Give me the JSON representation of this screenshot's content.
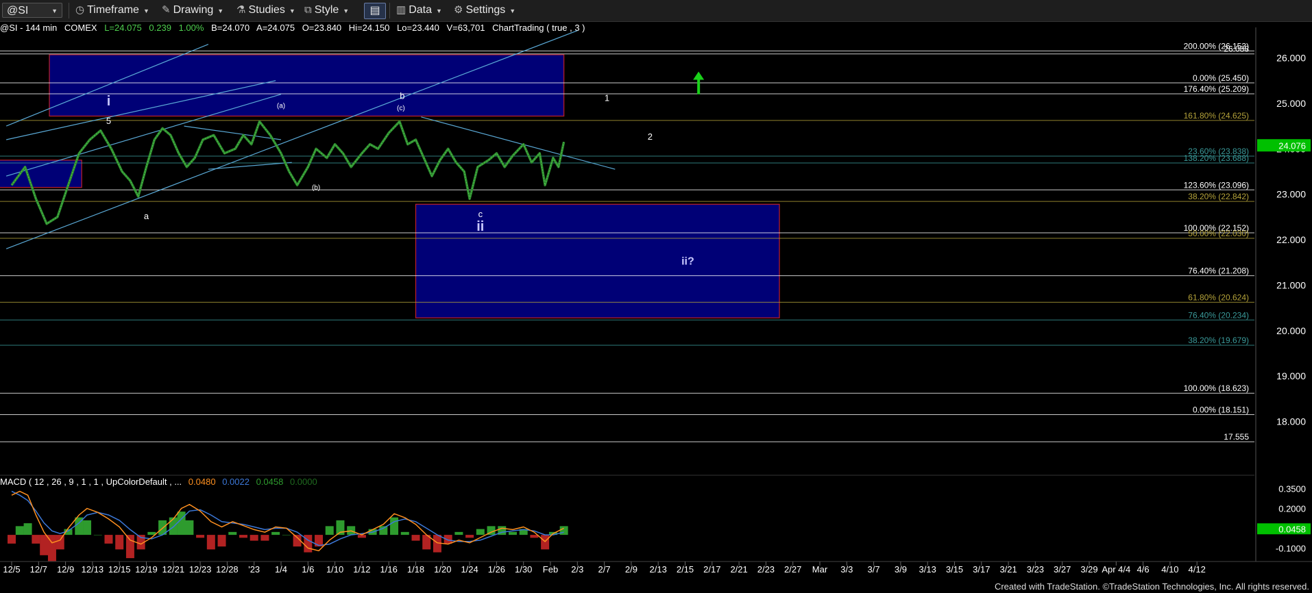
{
  "toolbar": {
    "symbol": "@SI",
    "menus": [
      "Timeframe",
      "Drawing",
      "Studies",
      "Style",
      "Data",
      "Settings"
    ]
  },
  "infobar": {
    "symbol_desc": "@SI - 144 min",
    "exchange": "COMEX",
    "last": "L=24.075",
    "change": "0.239",
    "change_pct": "1.00%",
    "bid": "B=24.070",
    "ask": "A=24.075",
    "open": "O=23.840",
    "high": "Hi=24.150",
    "low": "Lo=23.440",
    "volume": "V=63,701",
    "study": "ChartTrading ( true , 3 )"
  },
  "macd_label": {
    "params": "MACD ( 12 , 26 , 9 , 1 , 1 , UpColorDefault , ...",
    "v1": "0.0480",
    "v2": "0.0022",
    "v3": "0.0458",
    "v4": "0.0000"
  },
  "colors": {
    "background": "#000000",
    "box_fill": "#00008b",
    "box_border": "#c0202a",
    "trendline": "#5aa9d6",
    "price": "#2e8b2e",
    "macd_line": "#ff9020",
    "signal_line": "#3c78d8",
    "hist_up": "#2e9b2e",
    "hist_down": "#b22222",
    "last_price_tag": "#00c000",
    "arrow": "#1ad11a"
  },
  "chart_data": {
    "type": "line",
    "title": "@SI - 144 min COMEX",
    "ylim": [
      17.3,
      26.4
    ],
    "yticks": [
      "26.000",
      "25.000",
      "24.000",
      "23.000",
      "22.000",
      "21.000",
      "20.000",
      "19.000",
      "18.000"
    ],
    "last_price": "24.076",
    "xticks": [
      "12/5",
      "12/7",
      "12/9",
      "12/13",
      "12/15",
      "12/19",
      "12/21",
      "12/23",
      "12/28",
      "'23",
      "1/4",
      "1/6",
      "1/10",
      "1/12",
      "1/16",
      "1/18",
      "1/20",
      "1/24",
      "1/26",
      "1/30",
      "Feb",
      "2/3",
      "2/7",
      "2/9",
      "2/13",
      "2/15",
      "2/17",
      "2/21",
      "2/23",
      "2/27",
      "Mar",
      "3/3",
      "3/7",
      "3/9",
      "3/13",
      "3/15",
      "3/17",
      "3/21",
      "3/23",
      "3/27",
      "3/29",
      "Apr 4/4",
      "4/6",
      "4/10",
      "4/12"
    ],
    "price_series": [
      [
        0,
        23.2
      ],
      [
        0.5,
        23.6
      ],
      [
        0.9,
        22.9
      ],
      [
        1.3,
        22.35
      ],
      [
        1.7,
        22.5
      ],
      [
        2.1,
        23.2
      ],
      [
        2.5,
        23.9
      ],
      [
        2.9,
        24.2
      ],
      [
        3.3,
        24.4
      ],
      [
        3.7,
        24.0
      ],
      [
        4.1,
        23.5
      ],
      [
        4.4,
        23.3
      ],
      [
        4.7,
        22.95
      ],
      [
        5.0,
        23.6
      ],
      [
        5.3,
        24.2
      ],
      [
        5.6,
        24.45
      ],
      [
        5.9,
        24.3
      ],
      [
        6.2,
        23.9
      ],
      [
        6.5,
        23.6
      ],
      [
        6.8,
        23.8
      ],
      [
        7.1,
        24.2
      ],
      [
        7.5,
        24.3
      ],
      [
        7.9,
        23.9
      ],
      [
        8.3,
        24.0
      ],
      [
        8.6,
        24.3
      ],
      [
        8.9,
        24.1
      ],
      [
        9.2,
        24.6
      ],
      [
        9.6,
        24.3
      ],
      [
        10.0,
        23.9
      ],
      [
        10.3,
        23.5
      ],
      [
        10.6,
        23.2
      ],
      [
        11.0,
        23.6
      ],
      [
        11.3,
        24.0
      ],
      [
        11.7,
        23.8
      ],
      [
        12.0,
        24.1
      ],
      [
        12.3,
        23.9
      ],
      [
        12.6,
        23.6
      ],
      [
        13.0,
        23.9
      ],
      [
        13.3,
        24.1
      ],
      [
        13.6,
        24.0
      ],
      [
        14.0,
        24.35
      ],
      [
        14.4,
        24.6
      ],
      [
        14.7,
        24.1
      ],
      [
        15.0,
        24.2
      ],
      [
        15.3,
        23.8
      ],
      [
        15.6,
        23.4
      ],
      [
        15.9,
        23.75
      ],
      [
        16.2,
        24.0
      ],
      [
        16.5,
        23.7
      ],
      [
        16.8,
        23.5
      ],
      [
        17.0,
        22.9
      ],
      [
        17.3,
        23.6
      ],
      [
        17.7,
        23.75
      ],
      [
        18.0,
        23.9
      ],
      [
        18.3,
        23.6
      ],
      [
        18.6,
        23.85
      ],
      [
        19.0,
        24.1
      ],
      [
        19.3,
        23.7
      ],
      [
        19.6,
        23.9
      ],
      [
        19.8,
        23.2
      ],
      [
        20.1,
        23.8
      ],
      [
        20.3,
        23.6
      ],
      [
        20.5,
        24.15
      ]
    ],
    "boxes": [
      {
        "x0": 1.4,
        "x1": 20.5,
        "y0": 24.72,
        "y1": 26.07
      },
      {
        "x0": -0.5,
        "x1": 2.6,
        "y0": 23.15,
        "y1": 23.75
      },
      {
        "x0": 15.0,
        "x1": 28.5,
        "y0": 20.28,
        "y1": 22.78
      }
    ],
    "fib_levels": [
      {
        "label": "200.00% (26.153)",
        "value": 26.153,
        "color": "#ffffff"
      },
      {
        "label": "26.088",
        "value": 26.088,
        "color": "#ffffff"
      },
      {
        "label": "0.00% (25.450)",
        "value": 25.45,
        "color": "#ffffff"
      },
      {
        "label": "176.40% (25.209)",
        "value": 25.209,
        "color": "#ffffff"
      },
      {
        "label": "161.80% (24.625)",
        "value": 24.625,
        "color": "#b5a33a"
      },
      {
        "label": "23.60% (23.838)",
        "value": 23.838,
        "color": "#3a9a9a"
      },
      {
        "label": "138.20% (23.688)",
        "value": 23.688,
        "color": "#3a9a9a"
      },
      {
        "label": "123.60% (23.096)",
        "value": 23.096,
        "color": "#ffffff"
      },
      {
        "label": "38.20% (22.842)",
        "value": 22.842,
        "color": "#b5a33a"
      },
      {
        "label": "100.00% (22.152)",
        "value": 22.152,
        "color": "#ffffff"
      },
      {
        "label": "50.00% (22.030)",
        "value": 22.03,
        "color": "#b5a33a"
      },
      {
        "label": "76.40% (21.208)",
        "value": 21.208,
        "color": "#ffffff"
      },
      {
        "label": "61.80% (20.624)",
        "value": 20.624,
        "color": "#b5a33a"
      },
      {
        "label": "76.40% (20.234)",
        "value": 20.234,
        "color": "#3a9a9a"
      },
      {
        "label": "38.20% (19.679)",
        "value": 19.679,
        "color": "#3a9a9a"
      },
      {
        "label": "100.00% (18.623)",
        "value": 18.623,
        "color": "#ffffff"
      },
      {
        "label": "0.00% (18.151)",
        "value": 18.151,
        "color": "#ffffff"
      },
      {
        "label": "17.555",
        "value": 17.555,
        "color": "#ffffff"
      }
    ],
    "trendlines": [
      [
        [
          -0.2,
          21.8
        ],
        [
          21.0,
          26.6
        ]
      ],
      [
        [
          -0.2,
          23.4
        ],
        [
          10.0,
          25.2
        ]
      ],
      [
        [
          -0.2,
          24.5
        ],
        [
          7.3,
          26.3
        ]
      ],
      [
        [
          -0.2,
          24.2
        ],
        [
          9.8,
          25.5
        ]
      ],
      [
        [
          6.4,
          24.5
        ],
        [
          10.0,
          24.2
        ]
      ],
      [
        [
          7.3,
          23.55
        ],
        [
          10.4,
          23.7
        ]
      ],
      [
        [
          15.2,
          24.7
        ],
        [
          22.4,
          23.55
        ]
      ]
    ],
    "wave_labels": [
      {
        "text": "i",
        "x": 3.6,
        "y": 24.95,
        "size": "big"
      },
      {
        "text": "5",
        "x": 3.6,
        "y": 24.55,
        "size": "small"
      },
      {
        "text": "a",
        "x": 5.0,
        "y": 22.45,
        "size": "small"
      },
      {
        "text": "(a)",
        "x": 10.0,
        "y": 24.9,
        "size": "tiny"
      },
      {
        "text": "(b)",
        "x": 11.3,
        "y": 23.1,
        "size": "tiny"
      },
      {
        "text": "b",
        "x": 14.5,
        "y": 25.1,
        "size": "small"
      },
      {
        "text": "(c)",
        "x": 14.45,
        "y": 24.85,
        "size": "tiny"
      },
      {
        "text": "c",
        "x": 17.4,
        "y": 22.5,
        "size": "small"
      },
      {
        "text": "ii",
        "x": 17.4,
        "y": 22.2,
        "size": "big"
      },
      {
        "text": "1",
        "x": 22.1,
        "y": 25.05,
        "size": "small"
      },
      {
        "text": "2",
        "x": 23.7,
        "y": 24.2,
        "size": "small"
      },
      {
        "text": "ii?",
        "x": 25.1,
        "y": 21.45,
        "size": "mid"
      }
    ],
    "arrow": {
      "x": 25.5,
      "from": 25.2,
      "to": 25.7
    },
    "macd": {
      "ylim": [
        -0.16,
        0.42
      ],
      "yticks": [
        "0.3500",
        "0.2000",
        "0.0458",
        "-0.1000"
      ],
      "macd_line": [
        [
          0,
          0.3
        ],
        [
          0.3,
          0.33
        ],
        [
          0.6,
          0.3
        ],
        [
          0.9,
          0.15
        ],
        [
          1.2,
          0.02
        ],
        [
          1.5,
          -0.06
        ],
        [
          1.8,
          -0.04
        ],
        [
          2.1,
          0.05
        ],
        [
          2.5,
          0.15
        ],
        [
          2.8,
          0.2
        ],
        [
          3.2,
          0.17
        ],
        [
          3.6,
          0.12
        ],
        [
          4.0,
          0.06
        ],
        [
          4.4,
          -0.04
        ],
        [
          4.8,
          -0.07
        ],
        [
          5.2,
          -0.02
        ],
        [
          5.6,
          0.05
        ],
        [
          6.0,
          0.12
        ],
        [
          6.3,
          0.2
        ],
        [
          6.6,
          0.23
        ],
        [
          7.0,
          0.18
        ],
        [
          7.4,
          0.1
        ],
        [
          7.8,
          0.06
        ],
        [
          8.2,
          0.1
        ],
        [
          8.6,
          0.07
        ],
        [
          9.0,
          0.04
        ],
        [
          9.4,
          0.02
        ],
        [
          9.8,
          0.06
        ],
        [
          10.2,
          0.05
        ],
        [
          10.6,
          -0.02
        ],
        [
          11.0,
          -0.1
        ],
        [
          11.4,
          -0.12
        ],
        [
          11.8,
          -0.04
        ],
        [
          12.2,
          0.02
        ],
        [
          12.6,
          0.03
        ],
        [
          13.0,
          0.0
        ],
        [
          13.4,
          0.04
        ],
        [
          13.8,
          0.08
        ],
        [
          14.2,
          0.16
        ],
        [
          14.6,
          0.13
        ],
        [
          15.0,
          0.08
        ],
        [
          15.4,
          0.0
        ],
        [
          15.8,
          -0.06
        ],
        [
          16.2,
          -0.07
        ],
        [
          16.6,
          -0.04
        ],
        [
          17.0,
          -0.06
        ],
        [
          17.4,
          -0.02
        ],
        [
          17.8,
          0.02
        ],
        [
          18.2,
          0.05
        ],
        [
          18.6,
          0.04
        ],
        [
          19.0,
          0.06
        ],
        [
          19.4,
          0.02
        ],
        [
          19.8,
          -0.05
        ],
        [
          20.1,
          0.01
        ],
        [
          20.5,
          0.05
        ]
      ],
      "signal_line": [
        [
          0,
          0.33
        ],
        [
          0.3,
          0.3
        ],
        [
          0.6,
          0.26
        ],
        [
          0.9,
          0.18
        ],
        [
          1.2,
          0.09
        ],
        [
          1.5,
          0.03
        ],
        [
          1.8,
          0.01
        ],
        [
          2.1,
          0.03
        ],
        [
          2.5,
          0.09
        ],
        [
          2.8,
          0.15
        ],
        [
          3.2,
          0.17
        ],
        [
          3.6,
          0.15
        ],
        [
          4.0,
          0.11
        ],
        [
          4.4,
          0.04
        ],
        [
          4.8,
          -0.02
        ],
        [
          5.2,
          -0.03
        ],
        [
          5.6,
          0.0
        ],
        [
          6.0,
          0.06
        ],
        [
          6.3,
          0.12
        ],
        [
          6.6,
          0.18
        ],
        [
          7.0,
          0.19
        ],
        [
          7.4,
          0.15
        ],
        [
          7.8,
          0.1
        ],
        [
          8.2,
          0.09
        ],
        [
          8.6,
          0.08
        ],
        [
          9.0,
          0.06
        ],
        [
          9.4,
          0.04
        ],
        [
          9.8,
          0.05
        ],
        [
          10.2,
          0.05
        ],
        [
          10.6,
          0.02
        ],
        [
          11.0,
          -0.04
        ],
        [
          11.4,
          -0.08
        ],
        [
          11.8,
          -0.07
        ],
        [
          12.2,
          -0.03
        ],
        [
          12.6,
          0.0
        ],
        [
          13.0,
          0.01
        ],
        [
          13.4,
          0.02
        ],
        [
          13.8,
          0.05
        ],
        [
          14.2,
          0.1
        ],
        [
          14.6,
          0.12
        ],
        [
          15.0,
          0.1
        ],
        [
          15.4,
          0.05
        ],
        [
          15.8,
          0.0
        ],
        [
          16.2,
          -0.04
        ],
        [
          16.6,
          -0.05
        ],
        [
          17.0,
          -0.05
        ],
        [
          17.4,
          -0.04
        ],
        [
          17.8,
          -0.01
        ],
        [
          18.2,
          0.02
        ],
        [
          18.6,
          0.03
        ],
        [
          19.0,
          0.04
        ],
        [
          19.4,
          0.03
        ],
        [
          19.8,
          0.0
        ],
        [
          20.1,
          0.0
        ],
        [
          20.5,
          0.02
        ]
      ]
    }
  },
  "footer": "Created with TradeStation. ©TradeStation Technologies, Inc. All rights reserved."
}
